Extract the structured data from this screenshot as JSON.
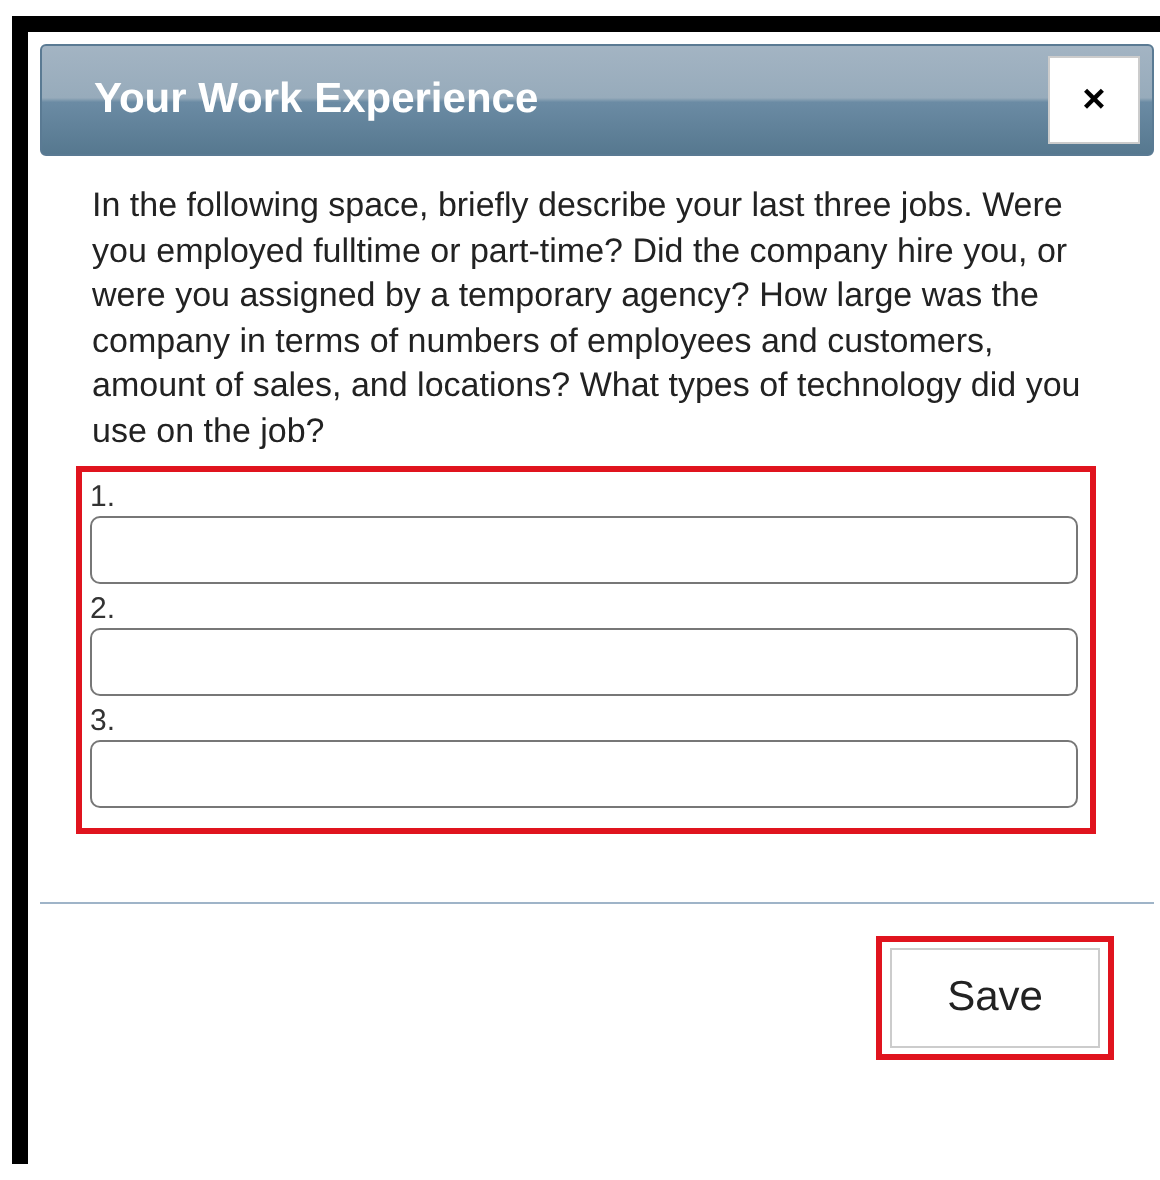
{
  "dialog": {
    "title": "Your Work Experience",
    "close_label": "×",
    "instructions": "In the following space, briefly describe your last three jobs. Were you employed fulltime or part-time? Did the company hire you, or were you assigned by a temporary agency? How large was the company in terms of numbers of employees and customers, amount of sales, and locations? What types of technology did you use on the job?",
    "fields": [
      {
        "label": "1."
      },
      {
        "label": "2."
      },
      {
        "label": "3."
      }
    ],
    "save_button": "Save"
  }
}
